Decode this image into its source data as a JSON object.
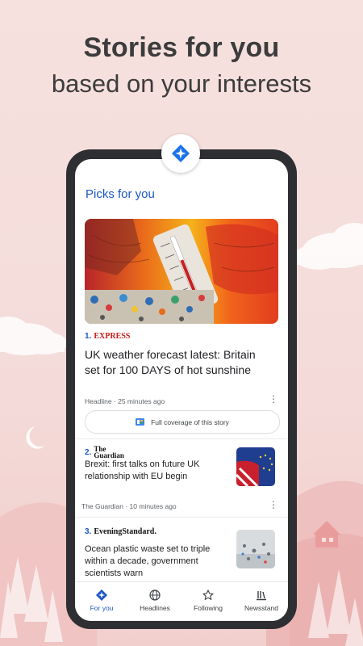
{
  "promo": {
    "headline": "Stories for you",
    "subheadline": "based on your interests"
  },
  "feed": {
    "section_title": "Picks for you",
    "items": [
      {
        "number": "1.",
        "source_logo_text": "EXPRESS",
        "title": "UK weather forecast latest: Britain set for 100 DAYS of hot sunshine",
        "meta": "Headline · 25 minutes ago",
        "coverage_label": "Full coverage of this story"
      },
      {
        "number": "2.",
        "source_logo_text_line1": "The",
        "source_logo_text_line2": "Guardian",
        "title": "Brexit: first talks on future UK relationship with EU begin",
        "meta": "The Guardian · 10 minutes ago"
      },
      {
        "number": "3.",
        "source_logo_text": "EveningStandard.",
        "title": "Ocean plastic waste set to triple within a decade, government scientists warn"
      }
    ]
  },
  "bottom_nav": [
    {
      "label": "For you",
      "icon": "for-you-diamond-icon",
      "active": true
    },
    {
      "label": "Headlines",
      "icon": "globe-icon",
      "active": false
    },
    {
      "label": "Following",
      "icon": "star-icon",
      "active": false
    },
    {
      "label": "Newsstand",
      "icon": "newsstand-bars-icon",
      "active": false
    }
  ],
  "colors": {
    "accent": "#1a56c4",
    "background": "#f6e1df",
    "phone_frame": "#2e2f33"
  }
}
